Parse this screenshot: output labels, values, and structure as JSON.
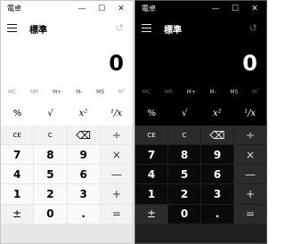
{
  "windows": [
    {
      "theme": "light",
      "title": "電卓",
      "titlebar_buttons": [
        "—",
        "☐",
        "✕"
      ],
      "mode": "標準",
      "display_value": "0",
      "memory_buttons": [
        "MC",
        "MR",
        "M+",
        "M-",
        "MS",
        "M˅"
      ],
      "function_keys": [
        "%",
        "√",
        "x²",
        "¹/x"
      ],
      "keypad": [
        "CE",
        "C",
        "⌫",
        "÷",
        "7",
        "8",
        "9",
        "×",
        "4",
        "5",
        "6",
        "—",
        "1",
        "2",
        "3",
        "+",
        "±",
        "0",
        ".",
        "="
      ]
    },
    {
      "theme": "dark",
      "title": "電卓",
      "titlebar_buttons": [
        "—",
        "☐",
        "✕"
      ],
      "mode": "標準",
      "display_value": "0",
      "memory_buttons": [
        "MC",
        "MR",
        "M+",
        "M-",
        "MS",
        "M˅"
      ],
      "function_keys": [
        "%",
        "√",
        "x²",
        "¹/x"
      ],
      "keypad": [
        "CE",
        "C",
        "⌫",
        "÷",
        "7",
        "8",
        "9",
        "×",
        "4",
        "5",
        "6",
        "—",
        "1",
        "2",
        "3",
        "+",
        "±",
        "0",
        ".",
        "="
      ]
    }
  ]
}
